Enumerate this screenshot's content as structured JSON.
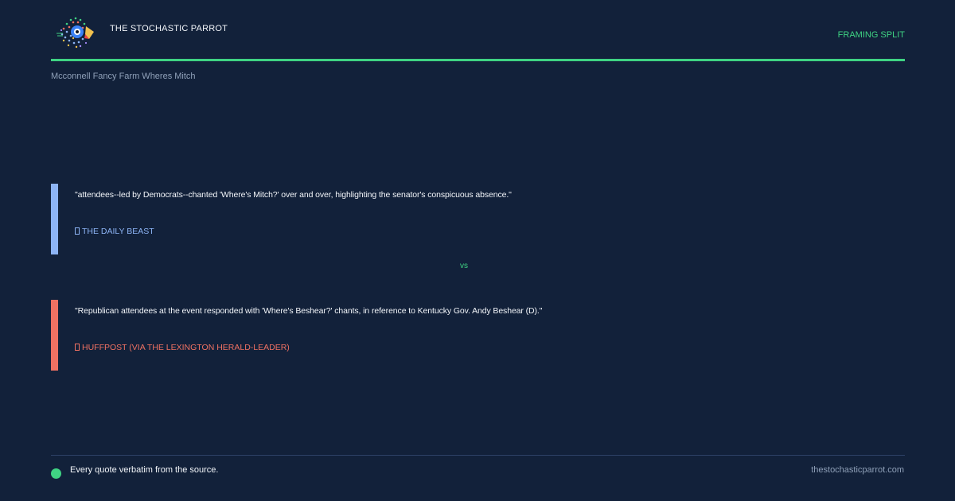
{
  "brand": {
    "name": "THE STOCHASTIC PARROT",
    "logo_icon": "parrot-logo-icon"
  },
  "header": {
    "badge": "FRAMING SPLIT"
  },
  "topic": "Mcconnell Fancy Farm Wheres Mitch",
  "quotes": [
    {
      "text": "\"attendees--led by Democrats--chanted 'Where's Mitch?' over and over, highlighting the senator's conspicuous absence.\"",
      "source": "THE DAILY BEAST",
      "source_icon": "source-icon",
      "color": "#8db4f5"
    },
    {
      "text": "\"Republican attendees at the event responded with 'Where's Beshear?' chants, in reference to Kentucky Gov. Andy Beshear (D).\"",
      "source": "HUFFPOST (VIA THE LEXINGTON HERALD-LEADER)",
      "source_icon": "source-icon",
      "color": "#ef7162"
    }
  ],
  "vs_label": "vs",
  "footer": {
    "note": "Every quote verbatim from the source.",
    "site": "thestochasticparrot.com"
  },
  "colors": {
    "background": "#12213a",
    "accent": "#3fd383",
    "left_frame": "#8db4f5",
    "right_frame": "#ef7162"
  }
}
